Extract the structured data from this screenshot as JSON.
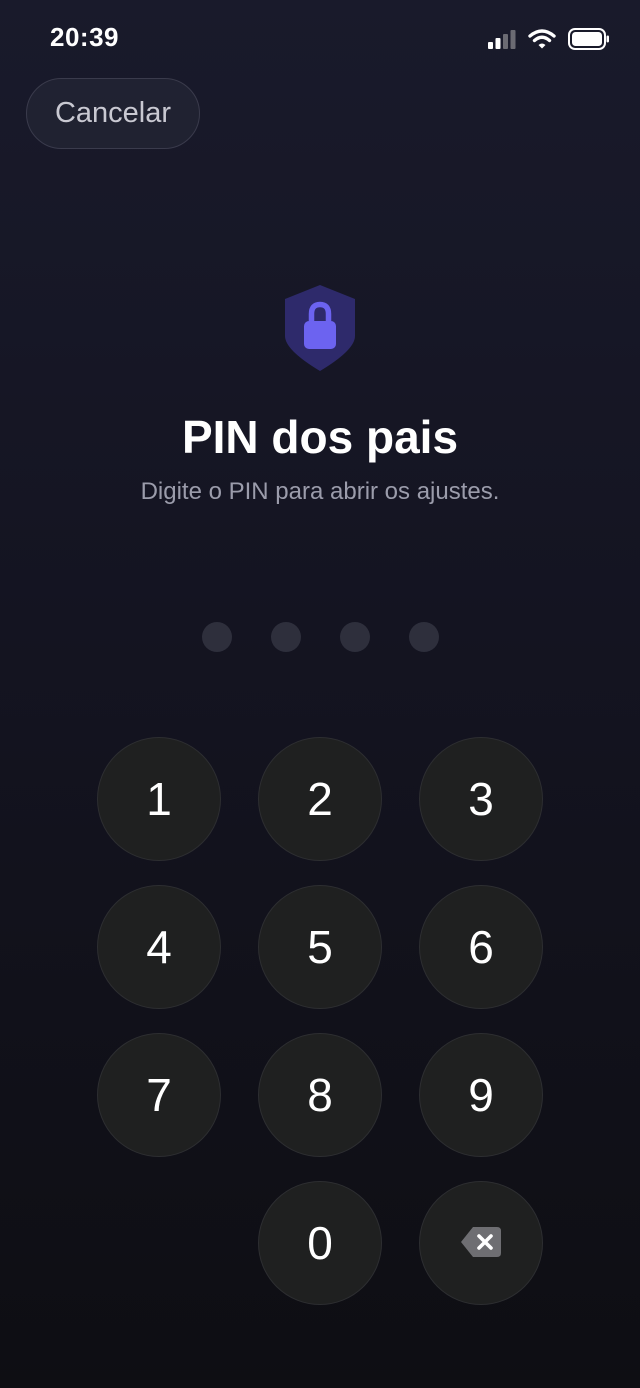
{
  "status_bar": {
    "time": "20:39",
    "icons": [
      "cellular-signal-icon",
      "wifi-icon",
      "battery-icon"
    ]
  },
  "header": {
    "cancel_label": "Cancelar"
  },
  "lock": {
    "icon": "shield-lock-icon",
    "title": "PIN dos pais",
    "subtitle": "Digite o PIN para abrir os ajustes."
  },
  "pin": {
    "length": 4,
    "entered": 0
  },
  "keypad": {
    "keys": [
      "1",
      "2",
      "3",
      "4",
      "5",
      "6",
      "7",
      "8",
      "9",
      "0"
    ],
    "backspace_icon": "backspace-icon"
  },
  "colors": {
    "accent": "#6c63f0",
    "shield": "#2e2a6b",
    "background_top": "#191a2b",
    "background_bottom": "#0e0e13",
    "key_background": "#1f2020",
    "pin_dot": "#2e2f3c",
    "subtitle": "#9b9cab"
  }
}
